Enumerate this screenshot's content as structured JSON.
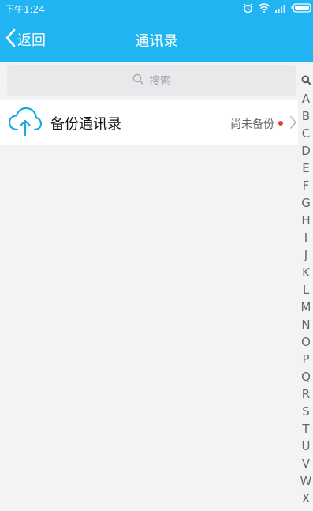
{
  "status_bar": {
    "time": "下午1:24",
    "icons": [
      "alarm-icon",
      "wifi-icon",
      "signal-icon",
      "battery-icon"
    ]
  },
  "nav": {
    "back_label": "返回",
    "title": "通讯录"
  },
  "search": {
    "placeholder": "搜索"
  },
  "backup_row": {
    "label": "备份通讯录",
    "status": "尚未备份",
    "icon": "cloud-upload-icon"
  },
  "alpha_index": [
    "A",
    "B",
    "C",
    "D",
    "E",
    "F",
    "G",
    "H",
    "I",
    "J",
    "K",
    "L",
    "M",
    "N",
    "O",
    "P",
    "Q",
    "R",
    "S",
    "T",
    "U",
    "V",
    "W",
    "X"
  ],
  "colors": {
    "header_bg": "#20b5f2",
    "page_bg": "#f3f3f5",
    "search_bg": "#e9e9eb",
    "accent_icon": "#1aa9e6",
    "badge_dot": "#e33d2e"
  }
}
